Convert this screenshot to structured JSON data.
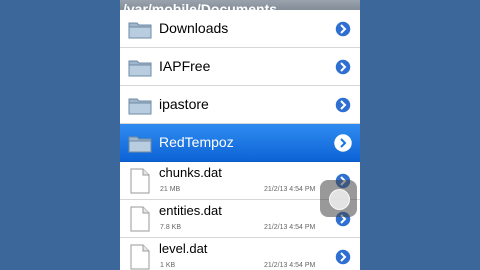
{
  "path_title": "/var/mobile/Documents",
  "folders": [
    {
      "name": "Downloads",
      "selected": false
    },
    {
      "name": "IAPFree",
      "selected": false
    },
    {
      "name": "ipastore",
      "selected": false
    },
    {
      "name": "RedTempoz",
      "selected": true
    }
  ],
  "files": [
    {
      "name": "chunks.dat",
      "size": "21 MB",
      "date": "21/2/13 4:54 PM"
    },
    {
      "name": "entities.dat",
      "size": "7.8 KB",
      "date": "21/2/13 4:54 PM"
    },
    {
      "name": "level.dat",
      "size": "1 KB",
      "date": "21/2/13 4:54 PM"
    }
  ],
  "colors": {
    "selection_blue": "#1677e6",
    "disclosure_blue": "#2f6fd1",
    "background": "#3b679b"
  },
  "icons": {
    "folder": "folder-icon",
    "file": "file-icon",
    "disclosure": "disclosure-arrow-icon",
    "assistive": "assistive-touch-icon"
  }
}
